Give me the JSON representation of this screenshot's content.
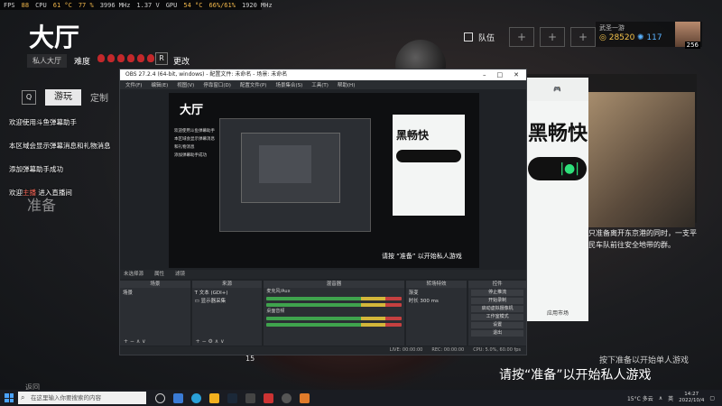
{
  "perf": {
    "fps_label": "FPS",
    "fps": "88",
    "cpu_label": "CPU",
    "cpu_temp": "61 °C",
    "cpu_load": "77 %",
    "cpu_clock": "3996 MHz",
    "volt": "1.37 V",
    "gpu_label": "GPU",
    "gpu_temp": "54 °C",
    "gpu_load": "66%/61%",
    "gpu_clock": "1920 MHz"
  },
  "game": {
    "title": "大厅",
    "private_room": "私人大厅",
    "difficulty_label": "难度",
    "key_r": "R",
    "change_label": "更改",
    "tab_q": "Q",
    "tab_play": "游玩",
    "tab_custom": "定制",
    "chat": [
      "欢迎使用斗鱼弹幕助手",
      "本区域会显示弹幕消息和礼物消息",
      "添加弹幕助手成功"
    ],
    "chat_last_prefix": "欢迎",
    "chat_last_name": "主播",
    "chat_last_suffix": "进入直播间",
    "ghost_text": "准备",
    "team_label": "队伍",
    "team_slot": "+",
    "player_name": "武圣一游",
    "coins": "28520",
    "gems": "117",
    "level": "256",
    "story_text": "只准备离开东京港的同时，一支平民车队前往安全地带的群。",
    "prompt_small": "按下准备以开始单人游戏",
    "prompt_big": "请按“准备”以开始私人游戏",
    "page_num": "15",
    "back_hint": "返回"
  },
  "ad": {
    "big_text": "黑畅快",
    "pill_icon": "|●|",
    "foot_label": "应用市场"
  },
  "obs": {
    "title": "OBS 27.2.4 (64-bit, windows) - 配置文件: 未命名 - 场景: 未命名",
    "menu": [
      "文件(F)",
      "编辑(E)",
      "视图(V)",
      "停靠窗口(D)",
      "配置文件(P)",
      "场景集合(S)",
      "工具(T)",
      "帮助(H)"
    ],
    "preview_title": "大厅",
    "preview_prompt": "请按 “准备” 以开始私人游戏",
    "scenebar": [
      "未选择源",
      "属性",
      "滤镜"
    ],
    "docks": {
      "scenes": {
        "title": "场景",
        "items": [
          "场景"
        ]
      },
      "sources": {
        "title": "来源",
        "items": [
          "文本 (GDI+)",
          "显示器采集"
        ]
      },
      "mixer": {
        "title": "混音器",
        "tracks": [
          "麦克风/Aux",
          "桌面音频"
        ]
      },
      "transitions": {
        "title": "转场特效",
        "type": "渐变",
        "duration_label": "时长",
        "duration": "300 ms"
      },
      "controls": {
        "title": "控件",
        "buttons": [
          "停止推流",
          "开始录制",
          "启动虚拟摄像机",
          "工作室模式",
          "设置",
          "退出"
        ]
      }
    },
    "status": [
      "LIVE: 00:00:00",
      "REC: 00:00:00",
      "CPU: 5.0%, 60.00 fps"
    ]
  },
  "taskbar": {
    "search_placeholder": "在这里输入你要搜索的内容",
    "weather": "15°C 多云",
    "lang": "英",
    "time": "14:27",
    "date": "2022/10/4"
  }
}
